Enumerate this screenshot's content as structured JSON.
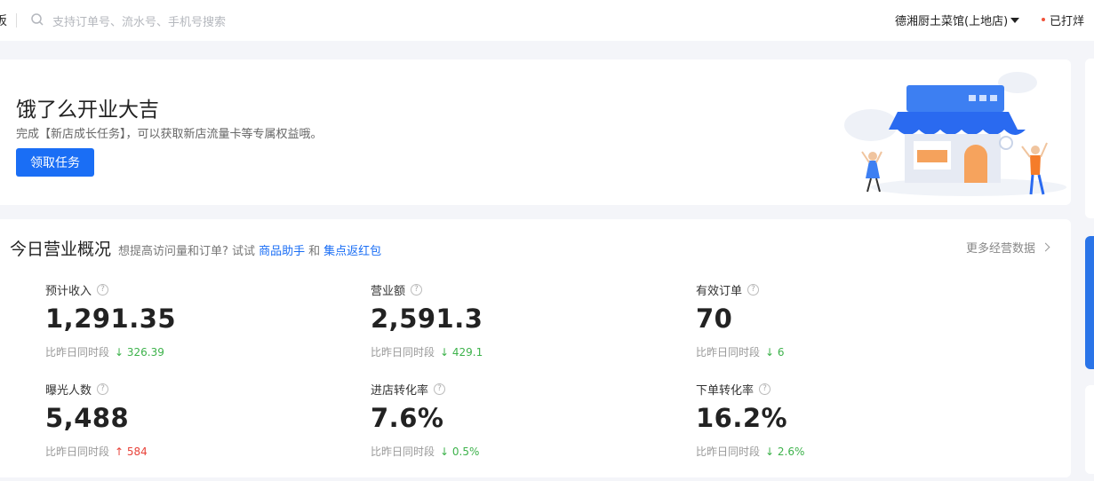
{
  "topbar": {
    "cut_glyph": "板",
    "search_placeholder": "支持订单号、流水号、手机号搜索",
    "store_name": "德湘厨土菜馆(上地店)",
    "print_status": "已打烊"
  },
  "banner": {
    "title": "饿了么开业大吉",
    "subtitle": "完成【新店成长任务】，可以获取新店流量卡等专属权益哦。",
    "button_label": "领取任务"
  },
  "overview": {
    "title": "今日营业概况",
    "hint": "想提高访问量和订单? 试试",
    "link_1": "商品助手",
    "and_text": "和",
    "link_2": "集点返红包",
    "more_label": "更多经营数据",
    "compare_label": "比昨日同时段",
    "metrics": [
      {
        "label": "预计收入",
        "value": "1,291.35",
        "delta": "↓ 326.39",
        "trend": "down"
      },
      {
        "label": "营业额",
        "value": "2,591.3",
        "delta": "↓ 429.1",
        "trend": "down"
      },
      {
        "label": "有效订单",
        "value": "70",
        "delta": "↓ 6",
        "trend": "down"
      },
      {
        "label": "曝光人数",
        "value": "5,488",
        "delta": "↑ 584",
        "trend": "up"
      },
      {
        "label": "进店转化率",
        "value": "7.6%",
        "delta": "↓ 0.5%",
        "trend": "down"
      },
      {
        "label": "下单转化率",
        "value": "16.2%",
        "delta": "↓ 2.6%",
        "trend": "down"
      }
    ]
  },
  "colors": {
    "accent": "#1a6ef5",
    "down": "#3db24b",
    "up": "#e8433a"
  }
}
